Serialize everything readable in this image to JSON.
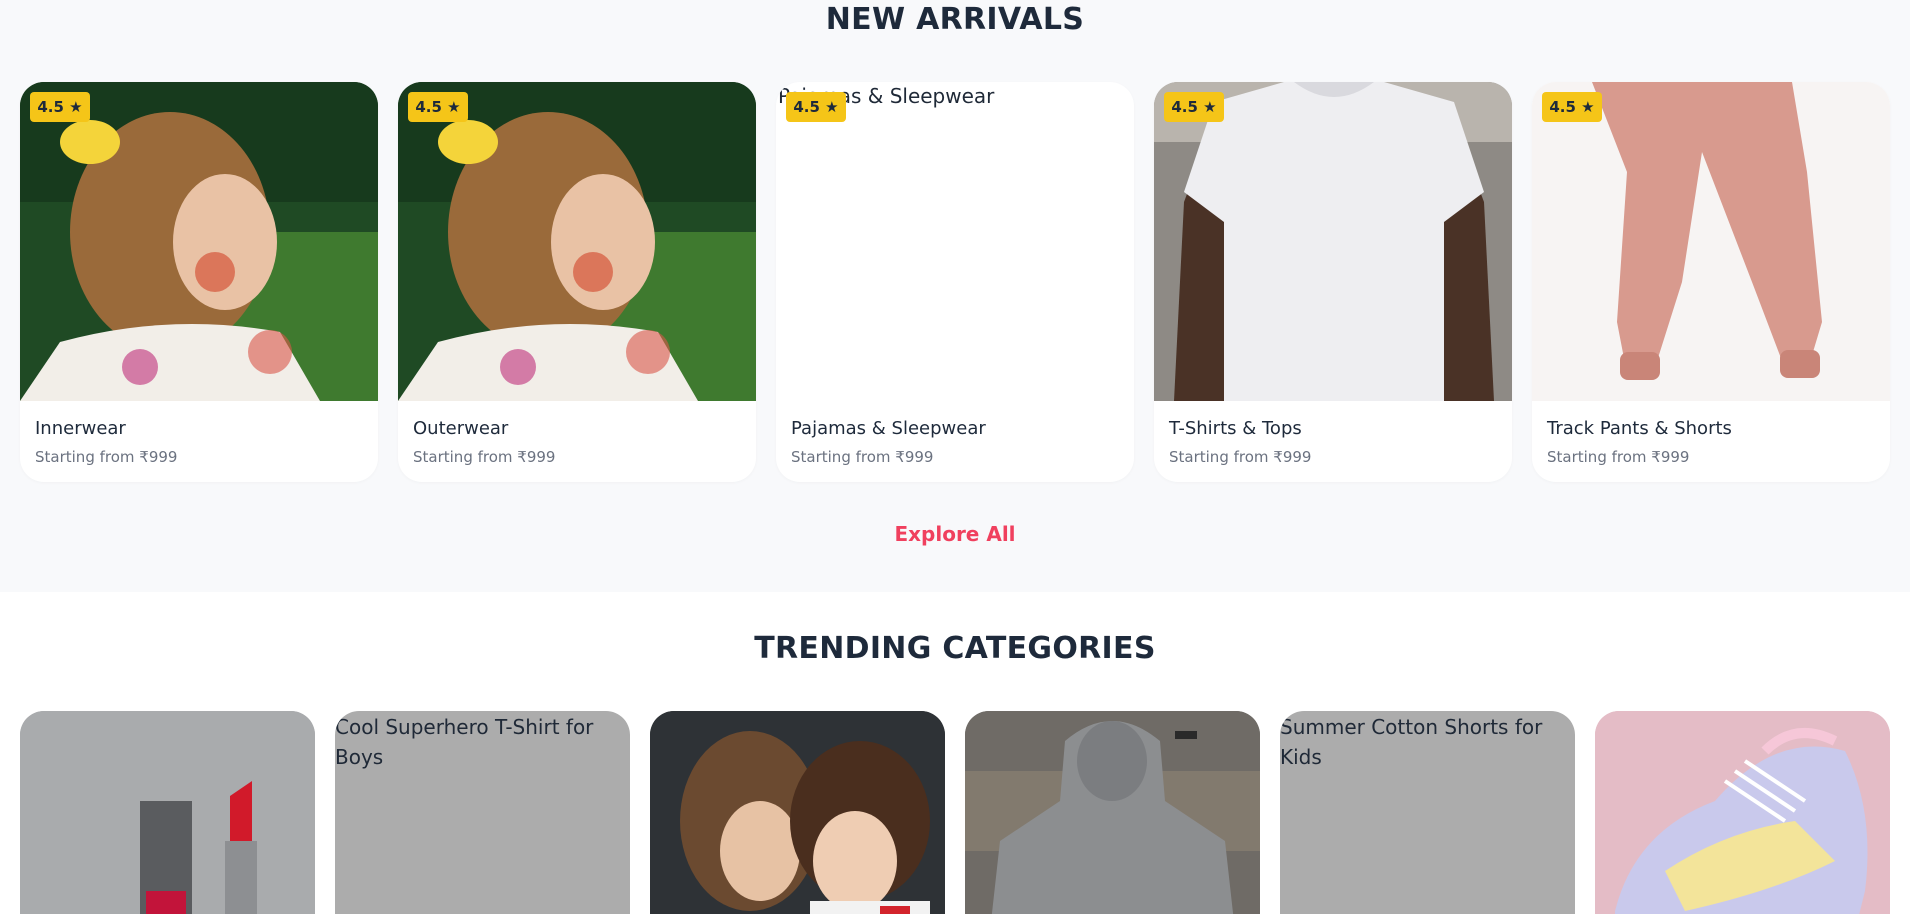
{
  "new_arrivals": {
    "title": "NEW ARRIVALS",
    "explore_label": "Explore All",
    "rating_icon": "star-icon",
    "cards": [
      {
        "name": "Innerwear",
        "price": "Starting from ₹999",
        "rating": "4.5 ★",
        "image": "girl-painted-face"
      },
      {
        "name": "Outerwear",
        "price": "Starting from ₹999",
        "rating": "4.5 ★",
        "image": "girl-painted-face"
      },
      {
        "name": "Pajamas & Sleepwear",
        "price": "Starting from ₹999",
        "rating": "4.5 ★",
        "image": "broken",
        "alt": "Pajamas & Sleepwear"
      },
      {
        "name": "T-Shirts & Tops",
        "price": "Starting from ₹999",
        "rating": "4.5 ★",
        "image": "white-tshirt"
      },
      {
        "name": "Track Pants & Shorts",
        "price": "Starting from ₹999",
        "rating": "4.5 ★",
        "image": "pink-track-pants"
      }
    ]
  },
  "trending": {
    "title": "TRENDING CATEGORIES",
    "cards": [
      {
        "image": "lipstick-cosmetics"
      },
      {
        "image": "broken",
        "alt": "Cool Superhero T-Shirt for Boys"
      },
      {
        "image": "kids-whispering"
      },
      {
        "image": "grey-hoodie"
      },
      {
        "image": "broken",
        "alt": "Summer Cotton Shorts for Kids"
      },
      {
        "image": "pastel-sneaker"
      }
    ]
  },
  "colors": {
    "accent": "#f0405e",
    "badge": "#f5c518",
    "heading": "#1e2a3b"
  }
}
